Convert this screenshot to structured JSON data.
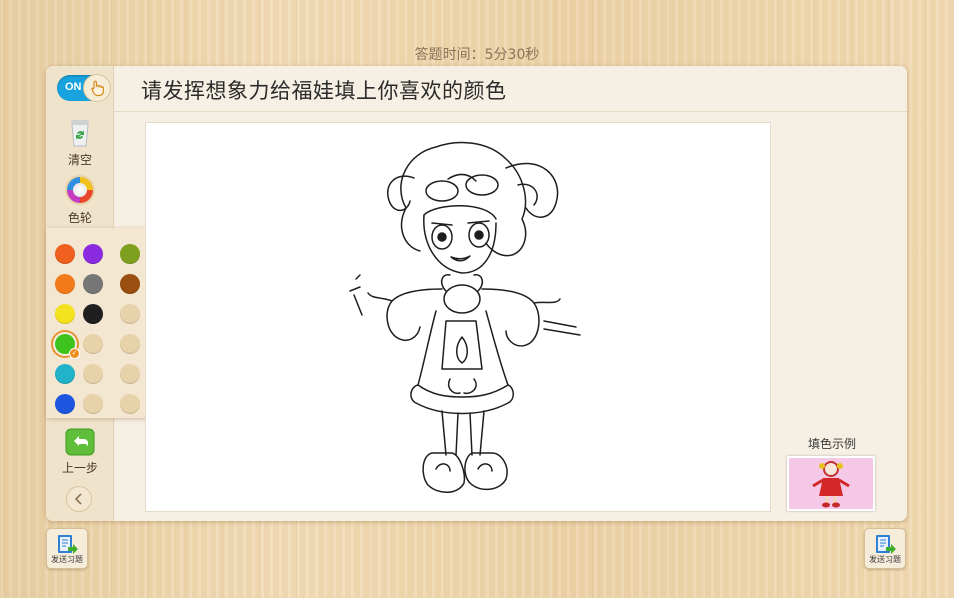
{
  "timer": "答题时间：5分30秒",
  "question": "请发挥想象力给福娃填上你喜欢的颜色",
  "toggle": {
    "label": "ON"
  },
  "tools": {
    "clear": "清空",
    "wheel": "色轮",
    "undo": "上一步"
  },
  "palette": {
    "colors": [
      "#f0601f",
      "#8a2be2",
      "#7ea01f",
      "#f37b1a",
      "#767676",
      "#9a4e10",
      "#f4e21e",
      "#1f1f1f",
      "#e8d2aa",
      "#3ec21c",
      "#e8d2aa",
      "#e8d2aa",
      "#21b3c9",
      "#e8d2aa",
      "#e8d2aa",
      "#1e56e0",
      "#e8d2aa",
      "#e8d2aa"
    ],
    "selected_index": 9
  },
  "sample_label": "填色示例",
  "send_buttons": {
    "left": "发送习题",
    "right": "发送习题"
  },
  "icons": [
    "hand-pointer-icon",
    "recycle-bin-icon",
    "color-wheel-icon",
    "undo-arrow-icon",
    "chevron-left-icon",
    "send-exercise-icon"
  ]
}
